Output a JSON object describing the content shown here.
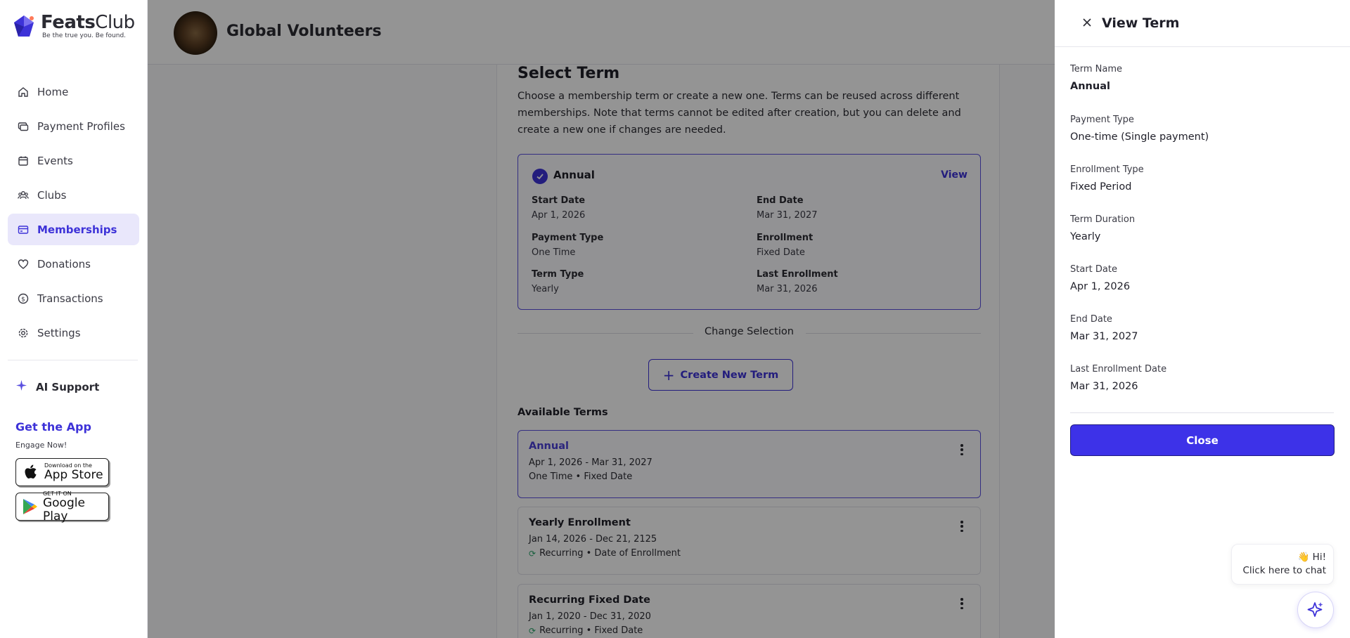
{
  "brand": {
    "name_bold": "Feats",
    "name_light": "Club",
    "tagline": "Be the true you. Be found.",
    "accent": "#3d32d8"
  },
  "sidebar": {
    "items": [
      {
        "label": "Home",
        "icon": "home-icon"
      },
      {
        "label": "Payment Profiles",
        "icon": "payment-profiles-icon"
      },
      {
        "label": "Events",
        "icon": "calendar-icon"
      },
      {
        "label": "Clubs",
        "icon": "users-icon"
      },
      {
        "label": "Memberships",
        "icon": "membership-card-icon",
        "active": true
      },
      {
        "label": "Donations",
        "icon": "heart-icon"
      },
      {
        "label": "Transactions",
        "icon": "dollar-icon"
      },
      {
        "label": "Settings",
        "icon": "gear-icon"
      }
    ],
    "ai_support": "AI Support",
    "get_app": "Get the App",
    "engage": "Engage Now!",
    "app_store": {
      "small": "Download on the",
      "big": "App Store"
    },
    "google_play": {
      "small": "GET IT ON",
      "big": "Google Play"
    }
  },
  "header": {
    "org_name": "Global Volunteers"
  },
  "select_term": {
    "title": "Select Term",
    "description": "Choose a membership term or create a new one. Terms can be reused across different memberships. Note that terms cannot be edited after creation, but you can delete and create a new one if changes are needed.",
    "selected": {
      "name": "Annual",
      "view_label": "View",
      "fields": [
        {
          "label": "Start Date",
          "value": "Apr 1, 2026"
        },
        {
          "label": "End Date",
          "value": "Mar 31, 2027"
        },
        {
          "label": "Payment Type",
          "value": "One Time"
        },
        {
          "label": "Enrollment",
          "value": "Fixed Date"
        },
        {
          "label": "Term Type",
          "value": "Yearly"
        },
        {
          "label": "Last Enrollment",
          "value": "Mar 31, 2026"
        }
      ]
    },
    "change_selection": "Change Selection",
    "create_new": "Create New Term",
    "available_title": "Available Terms",
    "terms": [
      {
        "name": "Annual",
        "dates": "Apr 1, 2026 - Mar 31, 2027",
        "meta": "One Time • Fixed Date",
        "recurring": false,
        "active": true
      },
      {
        "name": "Yearly Enrollment",
        "dates": "Jan 14, 2026 - Dec 21, 2125",
        "meta": "Recurring • Date of Enrollment",
        "recurring": true,
        "active": false
      },
      {
        "name": "Recurring Fixed Date",
        "dates": "Jan 1, 2020 - Dec 31, 2020",
        "meta": "Recurring • Fixed Date",
        "recurring": true,
        "active": false
      }
    ]
  },
  "drawer": {
    "title": "View Term",
    "fields": [
      {
        "label": "Term Name",
        "value": "Annual"
      },
      {
        "label": "Payment Type",
        "value": "One-time (Single payment)"
      },
      {
        "label": "Enrollment Type",
        "value": "Fixed Period"
      },
      {
        "label": "Term Duration",
        "value": "Yearly"
      },
      {
        "label": "Start Date",
        "value": "Apr 1, 2026"
      },
      {
        "label": "End Date",
        "value": "Mar 31, 2027"
      },
      {
        "label": "Last Enrollment Date",
        "value": "Mar 31, 2026"
      }
    ],
    "close_label": "Close"
  },
  "chat": {
    "greeting": "👋 Hi!",
    "prompt": "Click here to chat"
  }
}
